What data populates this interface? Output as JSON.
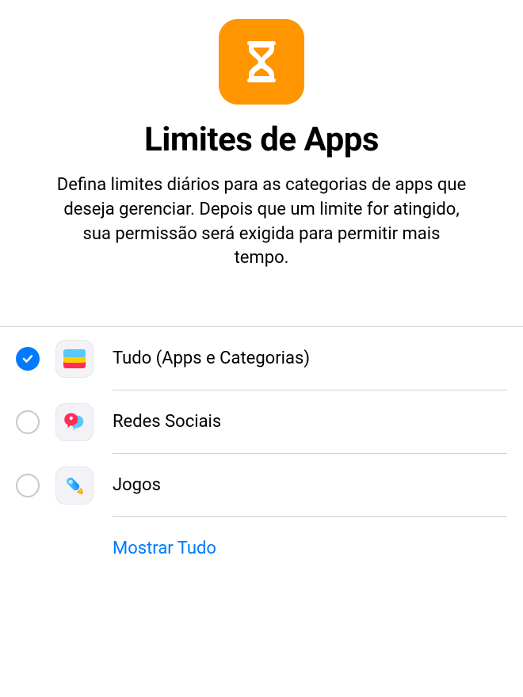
{
  "header": {
    "title": "Limites de Apps",
    "description": "Defina limites diários para as categorias de apps que deseja gerenciar. Depois que um limite for atingido, sua permissão será exigida para permitir mais tempo."
  },
  "categories": [
    {
      "label": "Tudo (Apps e Categorias)",
      "checked": true,
      "icon": "all-categories"
    },
    {
      "label": "Redes Sociais",
      "checked": false,
      "icon": "social"
    },
    {
      "label": "Jogos",
      "checked": false,
      "icon": "games"
    }
  ],
  "actions": {
    "show_all": "Mostrar Tudo"
  },
  "colors": {
    "accent_orange": "#FF9500",
    "accent_blue": "#007AFF"
  }
}
